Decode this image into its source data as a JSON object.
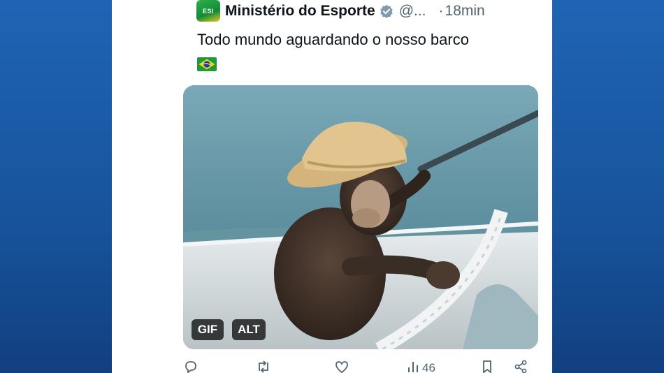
{
  "tweet": {
    "author_name": "Ministério do Esporte",
    "avatar_text": "ESI",
    "handle": "@...",
    "separator": "·",
    "time": "18min",
    "text": "Todo mundo aguardando o nosso barco",
    "flag_icon": "brazil-flag-icon"
  },
  "media": {
    "gif_label": "GIF",
    "alt_label": "ALT"
  },
  "actions": {
    "reply_icon": "reply-icon",
    "retweet_icon": "retweet-icon",
    "like_icon": "heart-icon",
    "views_icon": "views-chart-icon",
    "views_count": "46",
    "bookmark_icon": "bookmark-icon",
    "share_icon": "share-icon"
  },
  "colors": {
    "background_blue": "#1c5aa6",
    "verified_badge": "#829aab",
    "text_primary": "#0f1419",
    "text_secondary": "#536471"
  }
}
